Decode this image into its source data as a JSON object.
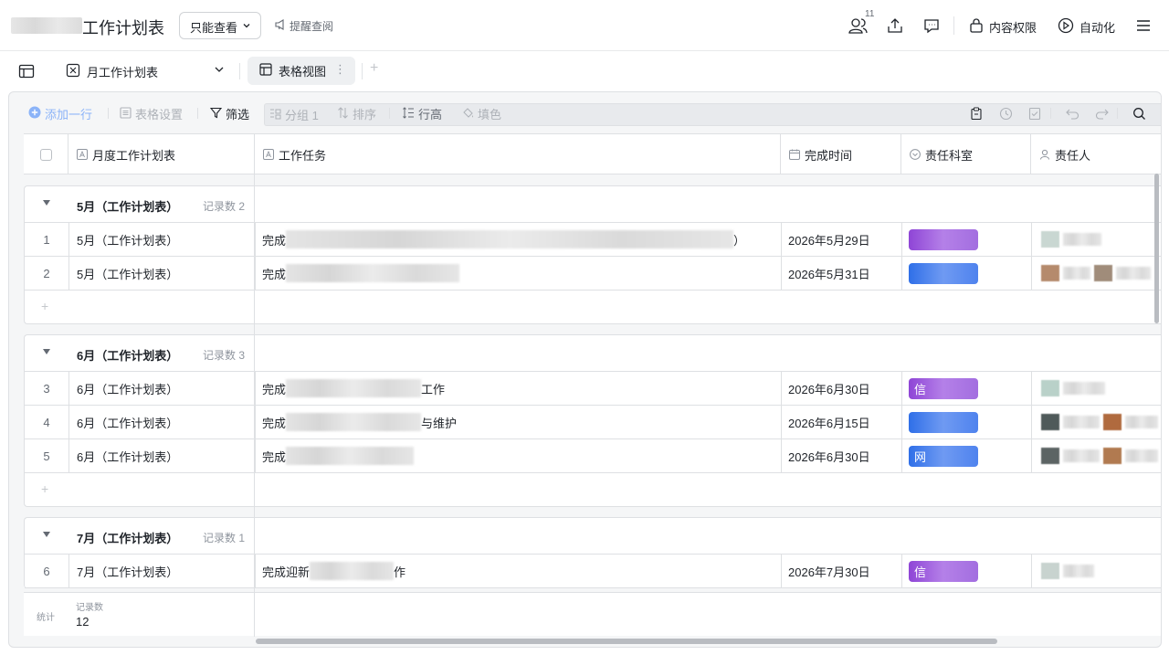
{
  "app": {
    "doc_title": "工作计划表",
    "permission_button": "只能查看",
    "remind_link": "提醒查阅",
    "collaborators_count": "11",
    "content_permission": "内容权限",
    "automation": "自动化"
  },
  "viewbar": {
    "table_name": "月工作计划表",
    "view_tab": "表格视图",
    "more": "⋮",
    "add": "+"
  },
  "toolbar": {
    "add_row": "添加一行",
    "table_settings": "表格设置",
    "filter": "筛选",
    "group": "分组 1",
    "sort": "排序",
    "row_height": "行高",
    "fill_color": "填色"
  },
  "columns": {
    "monthly_plan": "月度工作计划表",
    "task": "工作任务",
    "due_date": "完成时间",
    "department": "责任科室",
    "owner": "责任人"
  },
  "groups": [
    {
      "name": "5月（工作计划表）",
      "count": "记录数 2",
      "rows": [
        {
          "index": "1",
          "name": "5月（工作计划表）",
          "task_prefix": "完成",
          "task_suffix": "）",
          "date": "2026年5月29日",
          "dept": "",
          "dept_color": "#9b59dd"
        },
        {
          "index": "2",
          "name": "5月（工作计划表）",
          "task_prefix": "完成",
          "task_suffix": "",
          "date": "2026年5月31日",
          "dept": "",
          "dept_color": "#3a78ec"
        }
      ]
    },
    {
      "name": "6月（工作计划表）",
      "count": "记录数 3",
      "rows": [
        {
          "index": "3",
          "name": "6月（工作计划表）",
          "task_prefix": "完成",
          "task_suffix": "工作",
          "date": "2026年6月30日",
          "dept": "信",
          "dept_color": "#9b59dd"
        },
        {
          "index": "4",
          "name": "6月（工作计划表）",
          "task_prefix": "完成",
          "task_suffix": "与维护",
          "date": "2026年6月15日",
          "dept": "",
          "dept_color": "#6f9af2"
        },
        {
          "index": "5",
          "name": "6月（工作计划表）",
          "task_prefix": "完成",
          "task_suffix": "",
          "date": "2026年6月30日",
          "dept": "网",
          "dept_color": "#3a78ec"
        }
      ]
    },
    {
      "name": "7月（工作计划表）",
      "count": "记录数 1",
      "rows": [
        {
          "index": "6",
          "name": "7月（工作计划表）",
          "task_prefix": "完成迎新",
          "task_suffix": "作",
          "date": "2026年7月30日",
          "dept": "信",
          "dept_color": "#9b59dd"
        }
      ]
    }
  ],
  "footer": {
    "label": "统计",
    "sub": "记录数",
    "value": "12"
  }
}
